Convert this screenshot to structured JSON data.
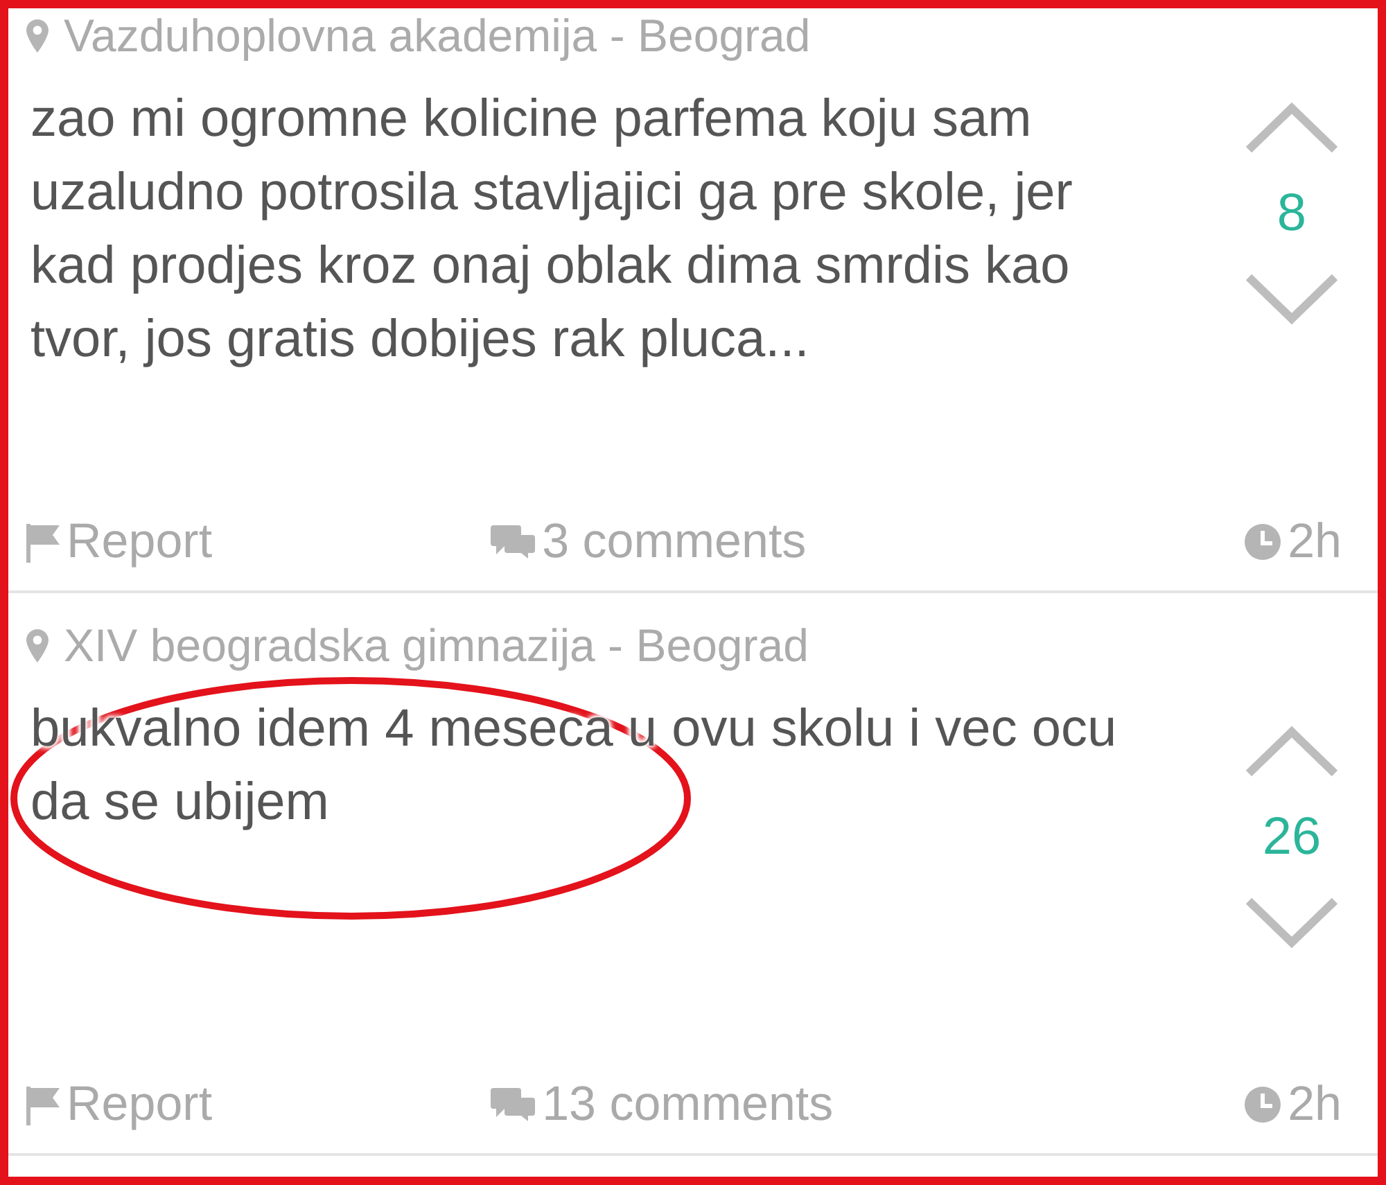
{
  "posts": [
    {
      "location": "Vazduhoplovna akademija - Beograd",
      "text": "zao mi ogromne kolicine parfema koju sam uzaludno potrosila stavljajici ga pre skole, jer kad prodjes kroz onaj oblak dima smrdis kao tvor, jos gratis dobijes rak pluca...",
      "score": "8",
      "report": "Report",
      "comments": "3 comments",
      "time": "2h"
    },
    {
      "location": "XIV beogradska gimnazija - Beograd",
      "text": "bukvalno idem 4 meseca u ovu skolu i vec ocu da se ubijem",
      "score": "26",
      "report": "Report",
      "comments": "13 comments",
      "time": "2h",
      "circled": true
    }
  ]
}
